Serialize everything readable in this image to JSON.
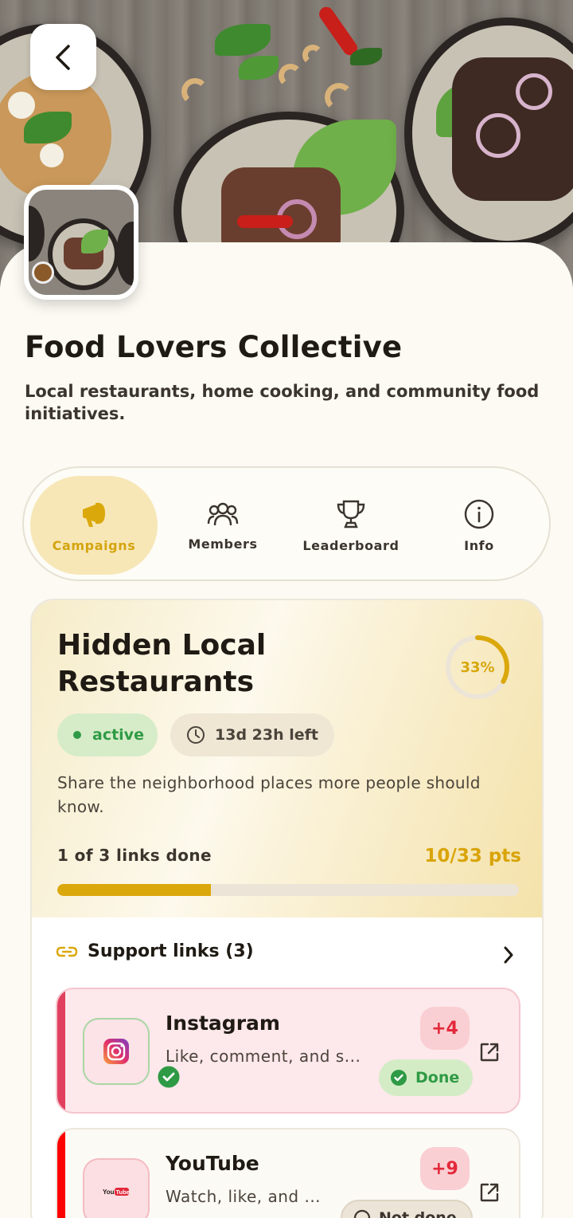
{
  "header": {
    "back_label": "Back"
  },
  "community": {
    "name": "Food Lovers Collective",
    "description": "Local restaurants, home cooking, and community food initiatives."
  },
  "tabs": [
    {
      "label": "Campaigns",
      "icon": "megaphone-icon",
      "active": true
    },
    {
      "label": "Members",
      "icon": "members-icon",
      "active": false
    },
    {
      "label": "Leaderboard",
      "icon": "trophy-icon",
      "active": false
    },
    {
      "label": "Info",
      "icon": "info-icon",
      "active": false
    }
  ],
  "campaign": {
    "title": "Hidden Local Restaurants",
    "progress_percent": 33,
    "progress_label": "33%",
    "status": "active",
    "time_left": "13d 23h left",
    "description": "Share the neighborhood places more people should know.",
    "links_done": "1 of 3 links done",
    "points": "10/33 pts",
    "bar_fraction": 0.333
  },
  "support_links": {
    "header": "Support links (3)",
    "items": [
      {
        "name": "Instagram",
        "subtitle": "Like, comment, and s...",
        "points": "+4",
        "status": "Done",
        "icon": "instagram-icon"
      },
      {
        "name": "YouTube",
        "subtitle": "Watch, like, and ...",
        "points": "+9",
        "status": "Not done",
        "icon": "youtube-icon"
      }
    ]
  },
  "colors": {
    "accent": "#dba80c",
    "active_green": "#2f9a45",
    "points_red": "#e3283a",
    "instagram_side": "#e0405e",
    "youtube_side": "#ff0000"
  }
}
